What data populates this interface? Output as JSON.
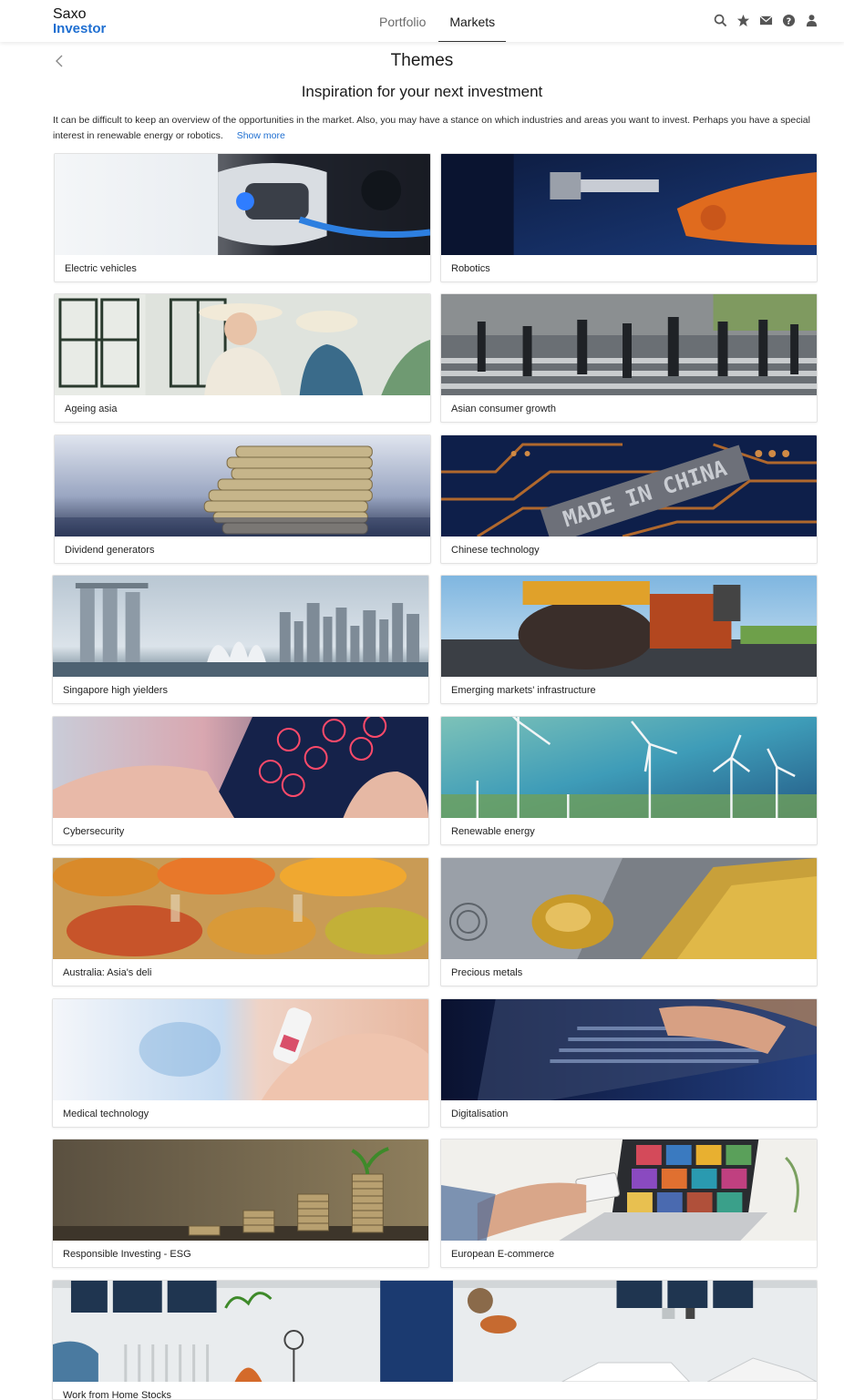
{
  "app": {
    "logo_line1": "Saxo",
    "logo_line2": "Investor",
    "accent": "#1f6fd1"
  },
  "nav": {
    "tabs": [
      {
        "label": "Portfolio"
      },
      {
        "label": "Markets"
      }
    ],
    "active": "Markets"
  },
  "toolbar_icons": [
    "search-icon",
    "star-icon",
    "mail-icon",
    "help-icon",
    "user-icon"
  ],
  "page": {
    "title": "Themes",
    "subtitle": "Inspiration for your next investment",
    "intro": "It can be difficult to keep an overview of the opportunities in the market. Also, you may have a stance on which industries and areas you want to invest. Perhaps you have a special interest in renewable energy or robotics.",
    "show_more": "Show more"
  },
  "themes": [
    {
      "label": "Electric vehicles"
    },
    {
      "label": "Robotics"
    },
    {
      "label": "Ageing asia"
    },
    {
      "label": "Asian consumer growth"
    },
    {
      "label": "Dividend generators"
    },
    {
      "label": "Chinese technology"
    },
    {
      "label": "Singapore high yielders"
    },
    {
      "label": "Emerging markets' infrastructure"
    },
    {
      "label": "Cybersecurity"
    },
    {
      "label": "Renewable energy"
    },
    {
      "label": "Australia: Asia's deli"
    },
    {
      "label": "Precious metals"
    },
    {
      "label": "Medical technology"
    },
    {
      "label": "Digitalisation"
    },
    {
      "label": "Responsible Investing - ESG"
    },
    {
      "label": "European E-commerce"
    },
    {
      "label": "Work from Home Stocks"
    }
  ],
  "image_text": {
    "chinese_technology": "MADE IN CHINA"
  }
}
